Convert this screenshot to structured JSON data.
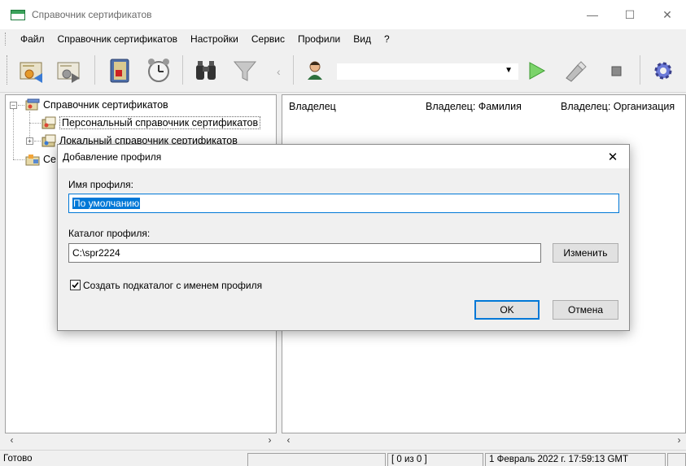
{
  "window": {
    "title": "Справочник сертификатов"
  },
  "menu": [
    "Файл",
    "Справочник сертификатов",
    "Настройки",
    "Сервис",
    "Профили",
    "Вид",
    "?"
  ],
  "toolbar": {
    "icons": [
      "certificate-import-icon",
      "certificate-export-icon",
      "address-book-icon",
      "alarm-clock-icon",
      "binoculars-icon",
      "filter-icon",
      "profile-user-icon",
      "play-icon",
      "usb-token-icon",
      "stop-icon",
      "settings-gear-icon"
    ],
    "profile_combo_value": ""
  },
  "tree": {
    "root": "Справочник сертификатов",
    "children": [
      "Персональный справочник сертификатов",
      "Локальный справочник сертификатов"
    ],
    "second_root_partial": "Се"
  },
  "list": {
    "columns": [
      "Владелец",
      "Владелец: Фамилия",
      "Владелец: Организация"
    ]
  },
  "status": {
    "left": "Готово",
    "count": "[ 0 из 0 ]",
    "datetime": "1 Февраль 2022 г. 17:59:13 GMT"
  },
  "dialog": {
    "title": "Добавление профиля",
    "profile_name_label": "Имя профиля:",
    "profile_name_value": "По умолчанию",
    "profile_dir_label": "Каталог профиля:",
    "profile_dir_value": "C:\\spr2224",
    "change_button": "Изменить",
    "create_subdir_label": "Создать подкаталог с именем профиля",
    "create_subdir_checked": true,
    "ok_button": "OK",
    "cancel_button": "Отмена"
  }
}
